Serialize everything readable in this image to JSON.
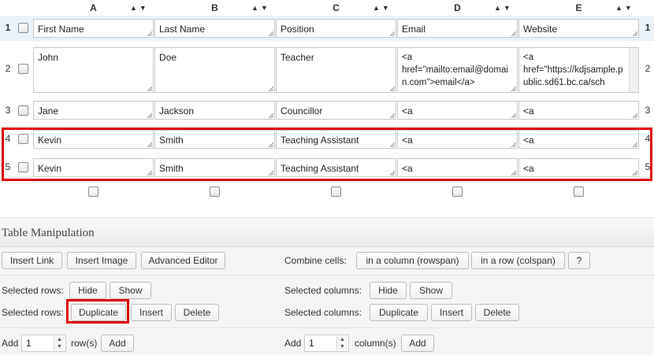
{
  "columns": [
    {
      "letter": "A",
      "sort": "▲▼"
    },
    {
      "letter": "B",
      "sort": "▲▼"
    },
    {
      "letter": "C",
      "sort": "▲▼"
    },
    {
      "letter": "D",
      "sort": "▲▼"
    },
    {
      "letter": "E",
      "sort": "▲▼"
    }
  ],
  "rows": [
    {
      "num": "1",
      "cells": [
        "First Name",
        "Last Name",
        "Position",
        "Email",
        "Website"
      ]
    },
    {
      "num": "2",
      "cells": [
        "John",
        "Doe",
        "Teacher",
        "<a\nhref=\"mailto:email@domain.com\">email</a>",
        "<a\nhref=\"https://kdjsample.public.sd61.bc.ca/sch"
      ]
    },
    {
      "num": "3",
      "cells": [
        "Jane",
        "Jackson",
        "Councillor",
        "<a",
        "<a"
      ]
    },
    {
      "num": "4",
      "cells": [
        "Kevin",
        "Smith",
        "Teaching Assistant",
        "<a",
        "<a"
      ]
    },
    {
      "num": "5",
      "cells": [
        "Kevin",
        "Smith",
        "Teaching Assistant",
        "<a",
        "<a"
      ]
    }
  ],
  "panel": {
    "title": "Table Manipulation",
    "insert_link": "Insert Link",
    "insert_image": "Insert Image",
    "advanced_editor": "Advanced Editor",
    "combine_cells_label": "Combine cells:",
    "rowspan": "in a column (rowspan)",
    "colspan": "in a row (colspan)",
    "help": "?",
    "selected_rows_label": "Selected rows:",
    "selected_columns_label": "Selected columns:",
    "hide": "Hide",
    "show": "Show",
    "duplicate": "Duplicate",
    "insert": "Insert",
    "delete": "Delete",
    "add_label": "Add",
    "add_rows_value": "1",
    "rows_suffix": "row(s)",
    "add_cols_value": "1",
    "cols_suffix": "column(s)",
    "add_button": "Add"
  },
  "colors": {
    "highlight": "#e00000",
    "header_row_bg": "#eaf2fa"
  }
}
